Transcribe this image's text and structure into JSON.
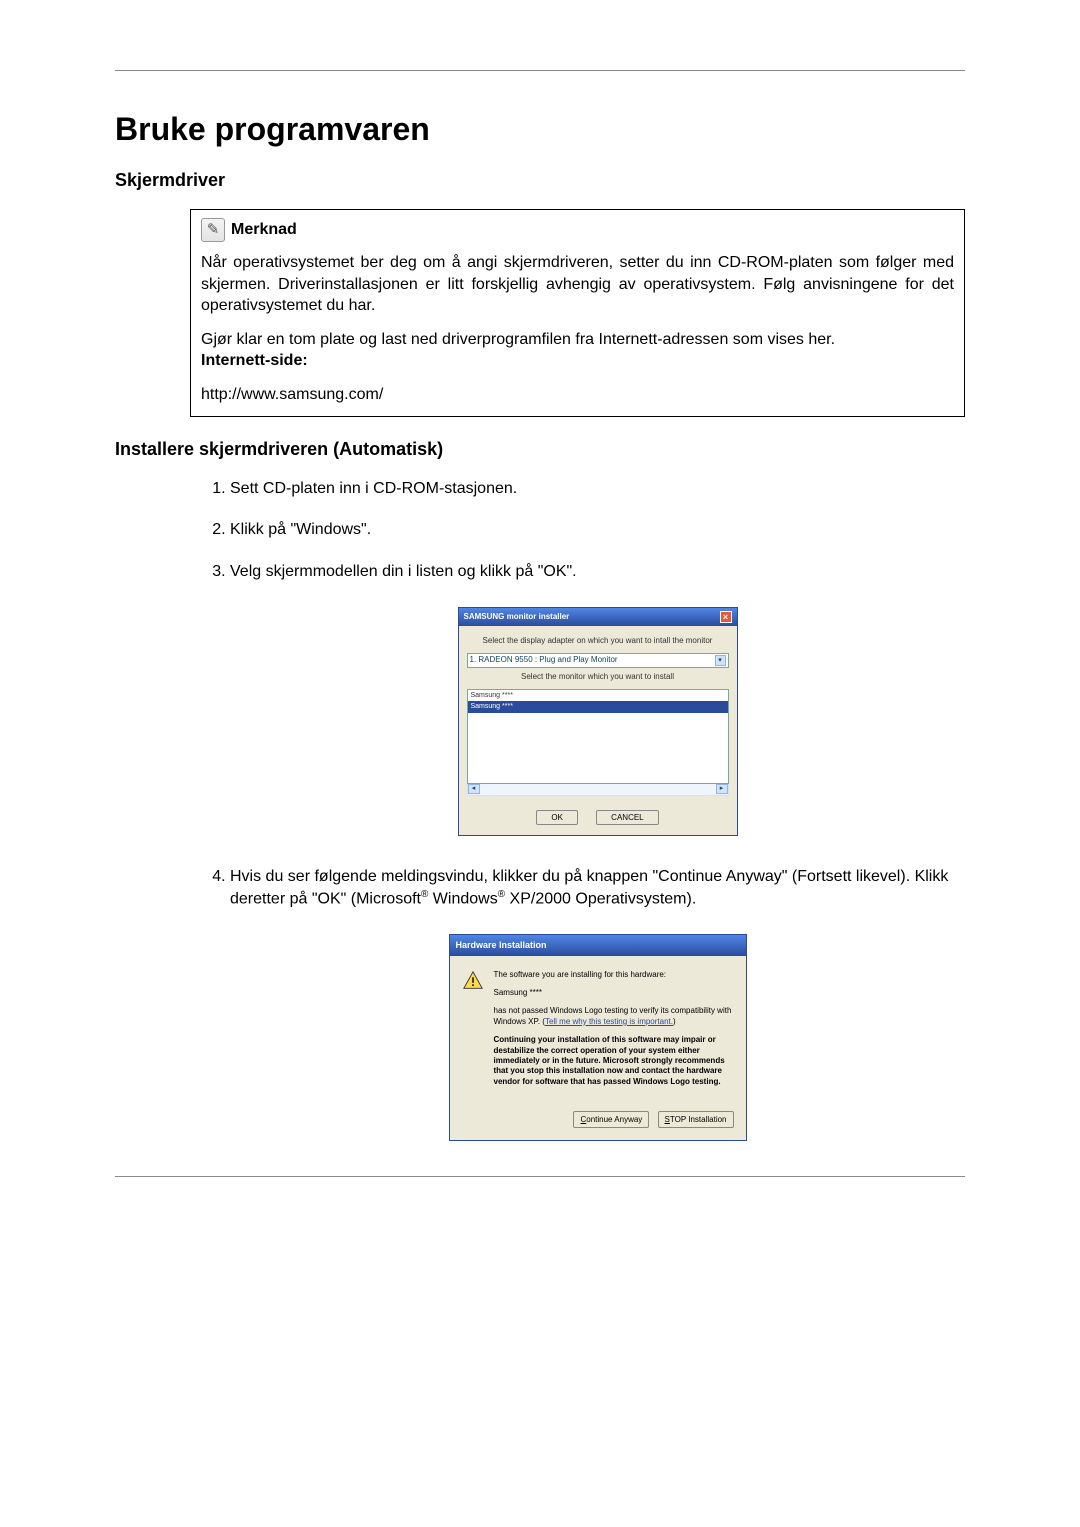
{
  "title": "Bruke programvaren",
  "section1": {
    "heading": "Skjermdriver",
    "note": {
      "label": "Merknad",
      "p1": "Når operativsystemet ber deg om å angi skjermdriveren, setter du inn CD-ROM-platen som følger med skjermen. Driverinstallasjonen er litt forskjellig avhengig av operativsystem. Følg anvisningene for det operativsystemet du har.",
      "p2": "Gjør klar en tom plate og last ned driverprogramfilen fra Internett-adressen som vises her.",
      "inet_label": "Internett-side:",
      "url": "http://www.samsung.com/"
    }
  },
  "section2": {
    "heading": "Installere skjermdriveren (Automatisk)",
    "steps": {
      "s1": "Sett CD-platen inn i CD-ROM-stasjonen.",
      "s2": "Klikk på \"Windows\".",
      "s3": "Velg skjermmodellen din i listen og klikk på \"OK\".",
      "s4a": "Hvis du ser følgende meldingsvindu, klikker du på knappen \"Continue Anyway\" (Fortsett likevel). Klikk deretter på \"OK\" (Microsoft",
      "s4b": " Windows",
      "s4c": " XP/2000 Operativsystem)."
    }
  },
  "dialog1": {
    "title": "SAMSUNG monitor installer",
    "instr1": "Select the display adapter on which you want to intall the monitor",
    "combo": "1. RADEON 9550 : Plug and Play Monitor",
    "instr2": "Select the monitor which you want to install",
    "list": {
      "item1": "Samsung ****",
      "item2": "Samsung ****"
    },
    "ok": "OK",
    "cancel": "CANCEL"
  },
  "dialog2": {
    "title": "Hardware Installation",
    "p1": "The software you are installing for this hardware:",
    "p2": "Samsung ****",
    "p3a": "has not passed Windows Logo testing to verify its compatibility with Windows XP. (",
    "p3link": "Tell me why this testing is important.",
    "p3b": ")",
    "p4": "Continuing your installation of this software may impair or destabilize the correct operation of your system either immediately or in the future. Microsoft strongly recommends that you stop this installation now and contact the hardware vendor for software that has passed Windows Logo testing.",
    "btn1_u": "C",
    "btn1_rest": "ontinue Anyway",
    "btn2_u": "S",
    "btn2_rest": "TOP Installation"
  }
}
